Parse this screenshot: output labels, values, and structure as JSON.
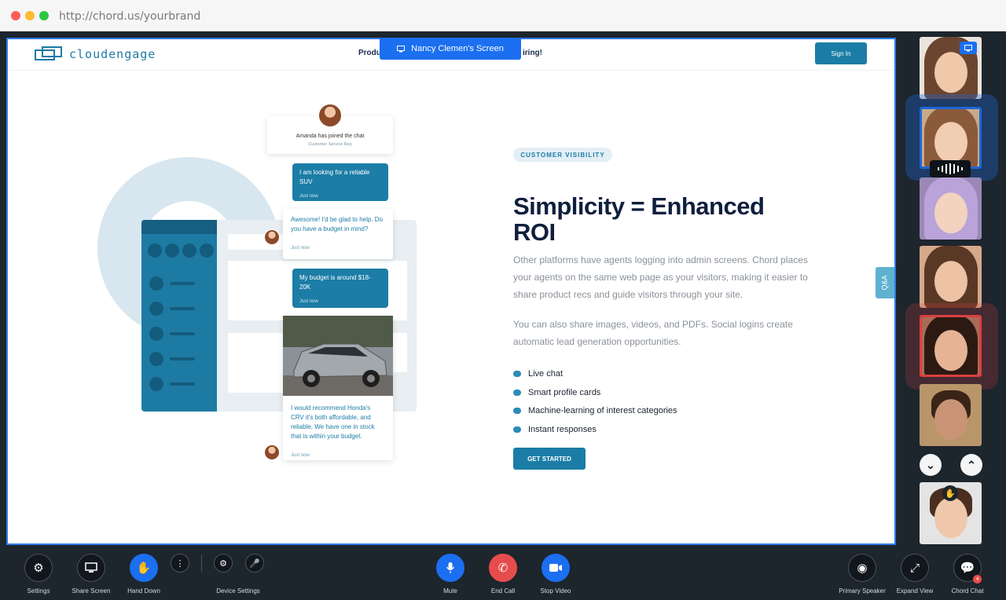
{
  "browser": {
    "url": "http://chord.us/yourbrand"
  },
  "screen_share": {
    "label": "Nancy Clemen's Screen",
    "icon": "screen-share-icon"
  },
  "site": {
    "logo": "cloudengage",
    "promo_left": "Produ",
    "promo_right": "iring!",
    "signin": "Sign In",
    "chat": {
      "joined": "Amanda has joined the chat",
      "role": "Customer Service Rep",
      "m1": "I am looking for a reliable SUV",
      "m1_time": "Just now",
      "m2": "Awesome! I'd be glad to help. Do you have a budget in mind?",
      "m2_time": "Just now",
      "m3": "My budget is around $18-20K",
      "m3_time": "Just now",
      "m4": "I would recommend Honda's CRV it's both affordable, and reliable, We have one in stock that is within your budget.",
      "m4_time": "Just now"
    },
    "tag": "CUSTOMER VISIBILITY",
    "headline": "Simplicity = Enhanced ROI",
    "para1": "Other platforms have agents logging into admin screens.  Chord places your agents on the same web page as your visitors, making it easier to share product recs and guide visitors through your site.",
    "para2": "You can also share images, videos, and PDFs. Social logins create automatic lead generation opportunities.",
    "features": [
      "Live chat",
      "Smart profile cards",
      "Machine-learning of interest categories",
      "Instant responses"
    ],
    "cta": "GET STARTED",
    "qa_tab": "Q&A"
  },
  "toolbar": {
    "settings": "Settings",
    "share_screen": "Share Screen",
    "hand_down": "Hand Down",
    "device_settings": "Device Settings",
    "mute": "Mute",
    "end_call": "End Call",
    "stop_video": "Stop Video",
    "primary_speaker": "Primary Speaker",
    "expand_view": "Expand View",
    "chord_chat": "Chord Chat",
    "chat_badge": "4"
  },
  "colors": {
    "accent": "#1b6ff0",
    "brand": "#1b7da6",
    "end_call": "#e74c4c",
    "speaking": "#1f66d8",
    "raised_hand": "#d94040"
  }
}
